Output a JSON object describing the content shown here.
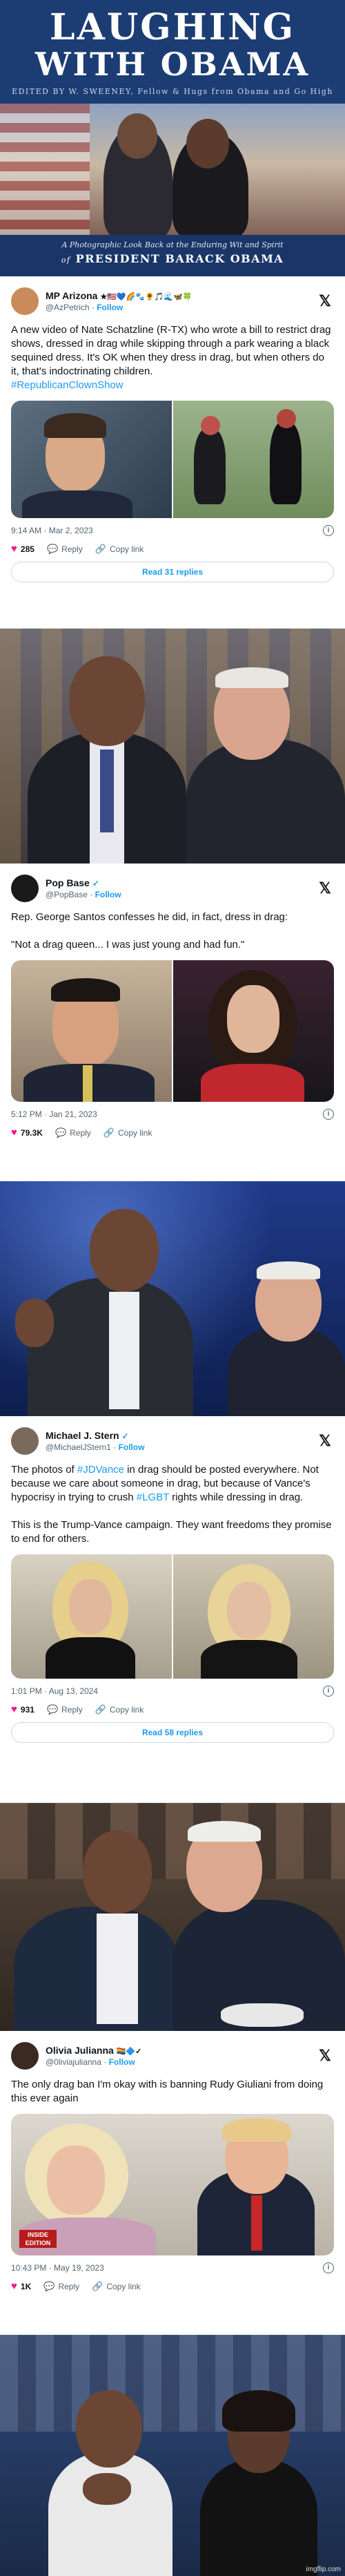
{
  "cover": {
    "title_line1": "LAUGHING",
    "title_line2": "WITH OBAMA",
    "editor_line": "EDITED BY  W. SWEENEY,  Fellow & Hugs from Obama and Go High",
    "subtitle": "A Photographic Look Back at the Enduring Wit and Spirit",
    "subtitle2_prefix": "of",
    "subtitle2_name": "PRESIDENT BARACK OBAMA"
  },
  "tweets": [
    {
      "name": "MP Arizona",
      "name_emojis": "★🇺🇸💙🌈🐾🌻🎵🌊🦋🍀",
      "handle": "@AzPetrich",
      "follow": "Follow",
      "text": "A new video of Nate Schatzline (R-TX) who wrote a bill to restrict drag shows, dressed in drag while skipping through a park wearing a black sequined dress. It's OK when they dress in drag, but when others do it,  that's indoctrinating children.",
      "hashtag": "#RepublicanClownShow",
      "time": "9:14 AM · Mar 2, 2023",
      "likes": "285",
      "reply": "Reply",
      "copy": "Copy link",
      "replies_button": "Read 31 replies",
      "avatar_color": "#c98b5a"
    },
    {
      "name": "Pop Base",
      "name_emojis": "✓",
      "handle": "@PopBase",
      "follow": "Follow",
      "text": "Rep. George Santos confesses he did, in fact, dress in drag:\n\n\"Not a drag queen... I was just young and had fun.\"",
      "hashtag": "",
      "time": "5:12 PM · Jan 21, 2023",
      "likes": "79.3K",
      "reply": "Reply",
      "copy": "Copy link",
      "replies_button": "",
      "avatar_color": "#1a1a1a"
    },
    {
      "name": "Michael J. Stern",
      "name_emojis": "✓",
      "handle": "@MichaelJStern1",
      "follow": "Follow",
      "text_pre": "The photos of ",
      "text_tag1": "#JDVance",
      "text_mid": " in drag should be posted everywhere.  Not because we care about someone in drag, but because of Vance's hypocrisy in trying to crush ",
      "text_tag2": "#LGBT",
      "text_post": " rights while dressing in drag.\n\nThis is the Trump-Vance campaign.  They want freedoms they promise to end for others.",
      "time": "1:01 PM · Aug 13, 2024",
      "likes": "931",
      "reply": "Reply",
      "copy": "Copy link",
      "replies_button": "Read 58 replies",
      "avatar_color": "#7a6a5c"
    },
    {
      "name": "Olivia Julianna",
      "name_emojis": "🏳️‍🌈🔷✓",
      "handle": "@0liviajulianna",
      "follow": "Follow",
      "text": "The only drag ban I'm okay with is banning Rudy Giuliani from doing this ever again",
      "hashtag": "",
      "time": "10:43 PM · May 19, 2023",
      "likes": "1K",
      "reply": "Reply",
      "copy": "Copy link",
      "replies_button": "",
      "avatar_color": "#3a2a22",
      "media_badge": "INSIDE EDITION"
    }
  ],
  "icons": {
    "x_logo": "x-logo-icon",
    "heart": "heart-icon",
    "reply": "reply-icon",
    "link": "link-icon",
    "info": "info-icon"
  },
  "colors": {
    "accent": "#1d9bf0",
    "heart": "#f91880",
    "cover_blue": "#1c3d73"
  },
  "watermark": "imgflip.com"
}
